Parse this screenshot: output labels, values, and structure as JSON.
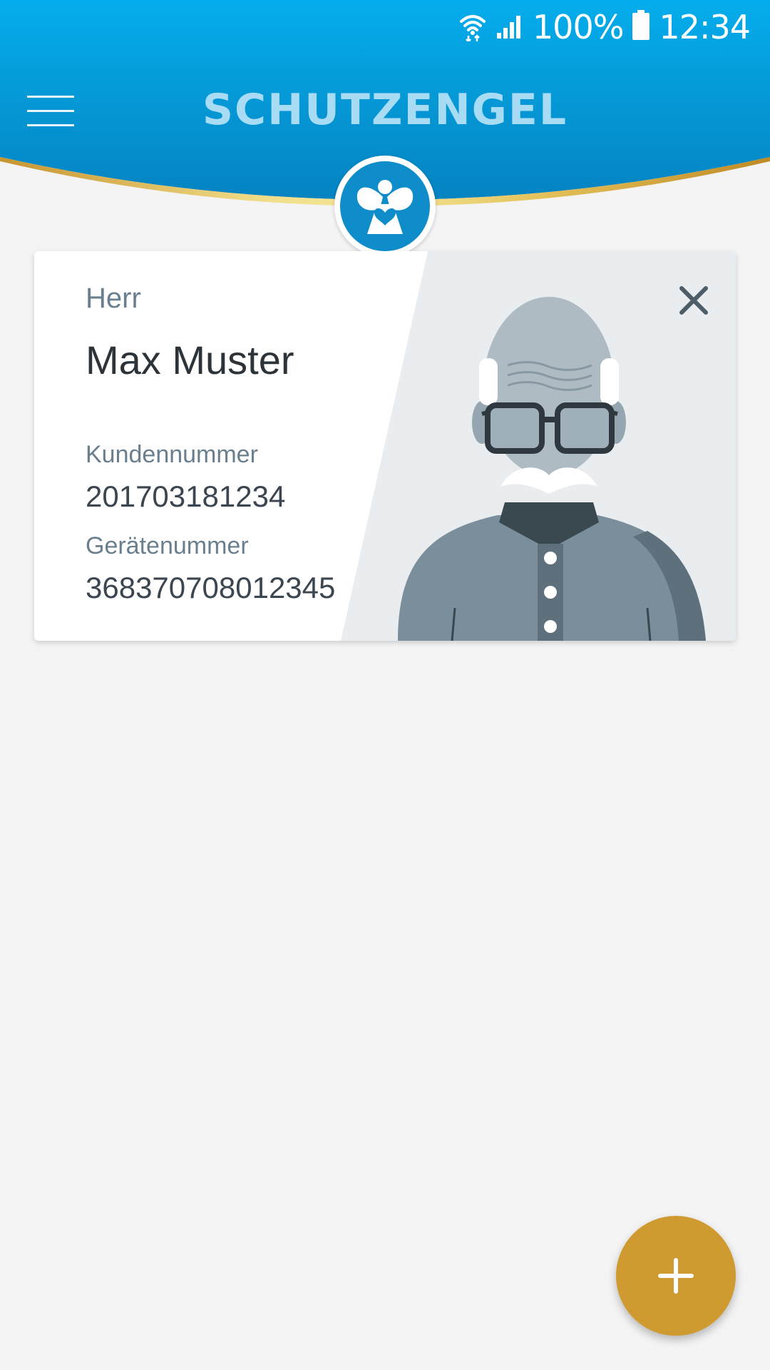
{
  "status_bar": {
    "battery": "100%",
    "time": "12:34",
    "icons": [
      "wifi-icon",
      "signal-icon",
      "battery-icon"
    ]
  },
  "app_bar": {
    "title": "SCHUTZENGEL",
    "menu_icon": "hamburger-menu-icon",
    "logo_icon": "angel-heart-logo-icon"
  },
  "profile_card": {
    "salutation": "Herr",
    "name": "Max Muster",
    "customer_number_label": "Kundennummer",
    "customer_number": "201703181234",
    "device_number_label": "Gerätenummer",
    "device_number": "368370708012345",
    "close_icon": "close-icon",
    "illustration": "elderly-man-avatar"
  },
  "fab": {
    "icon": "plus-icon"
  },
  "colors": {
    "header_blue": "#0a9ad8",
    "title_light_blue": "#a7dcf4",
    "gold_accent": "#cf9b30",
    "background": "#f4f4f5",
    "card_right_bg": "#eaedf0"
  }
}
